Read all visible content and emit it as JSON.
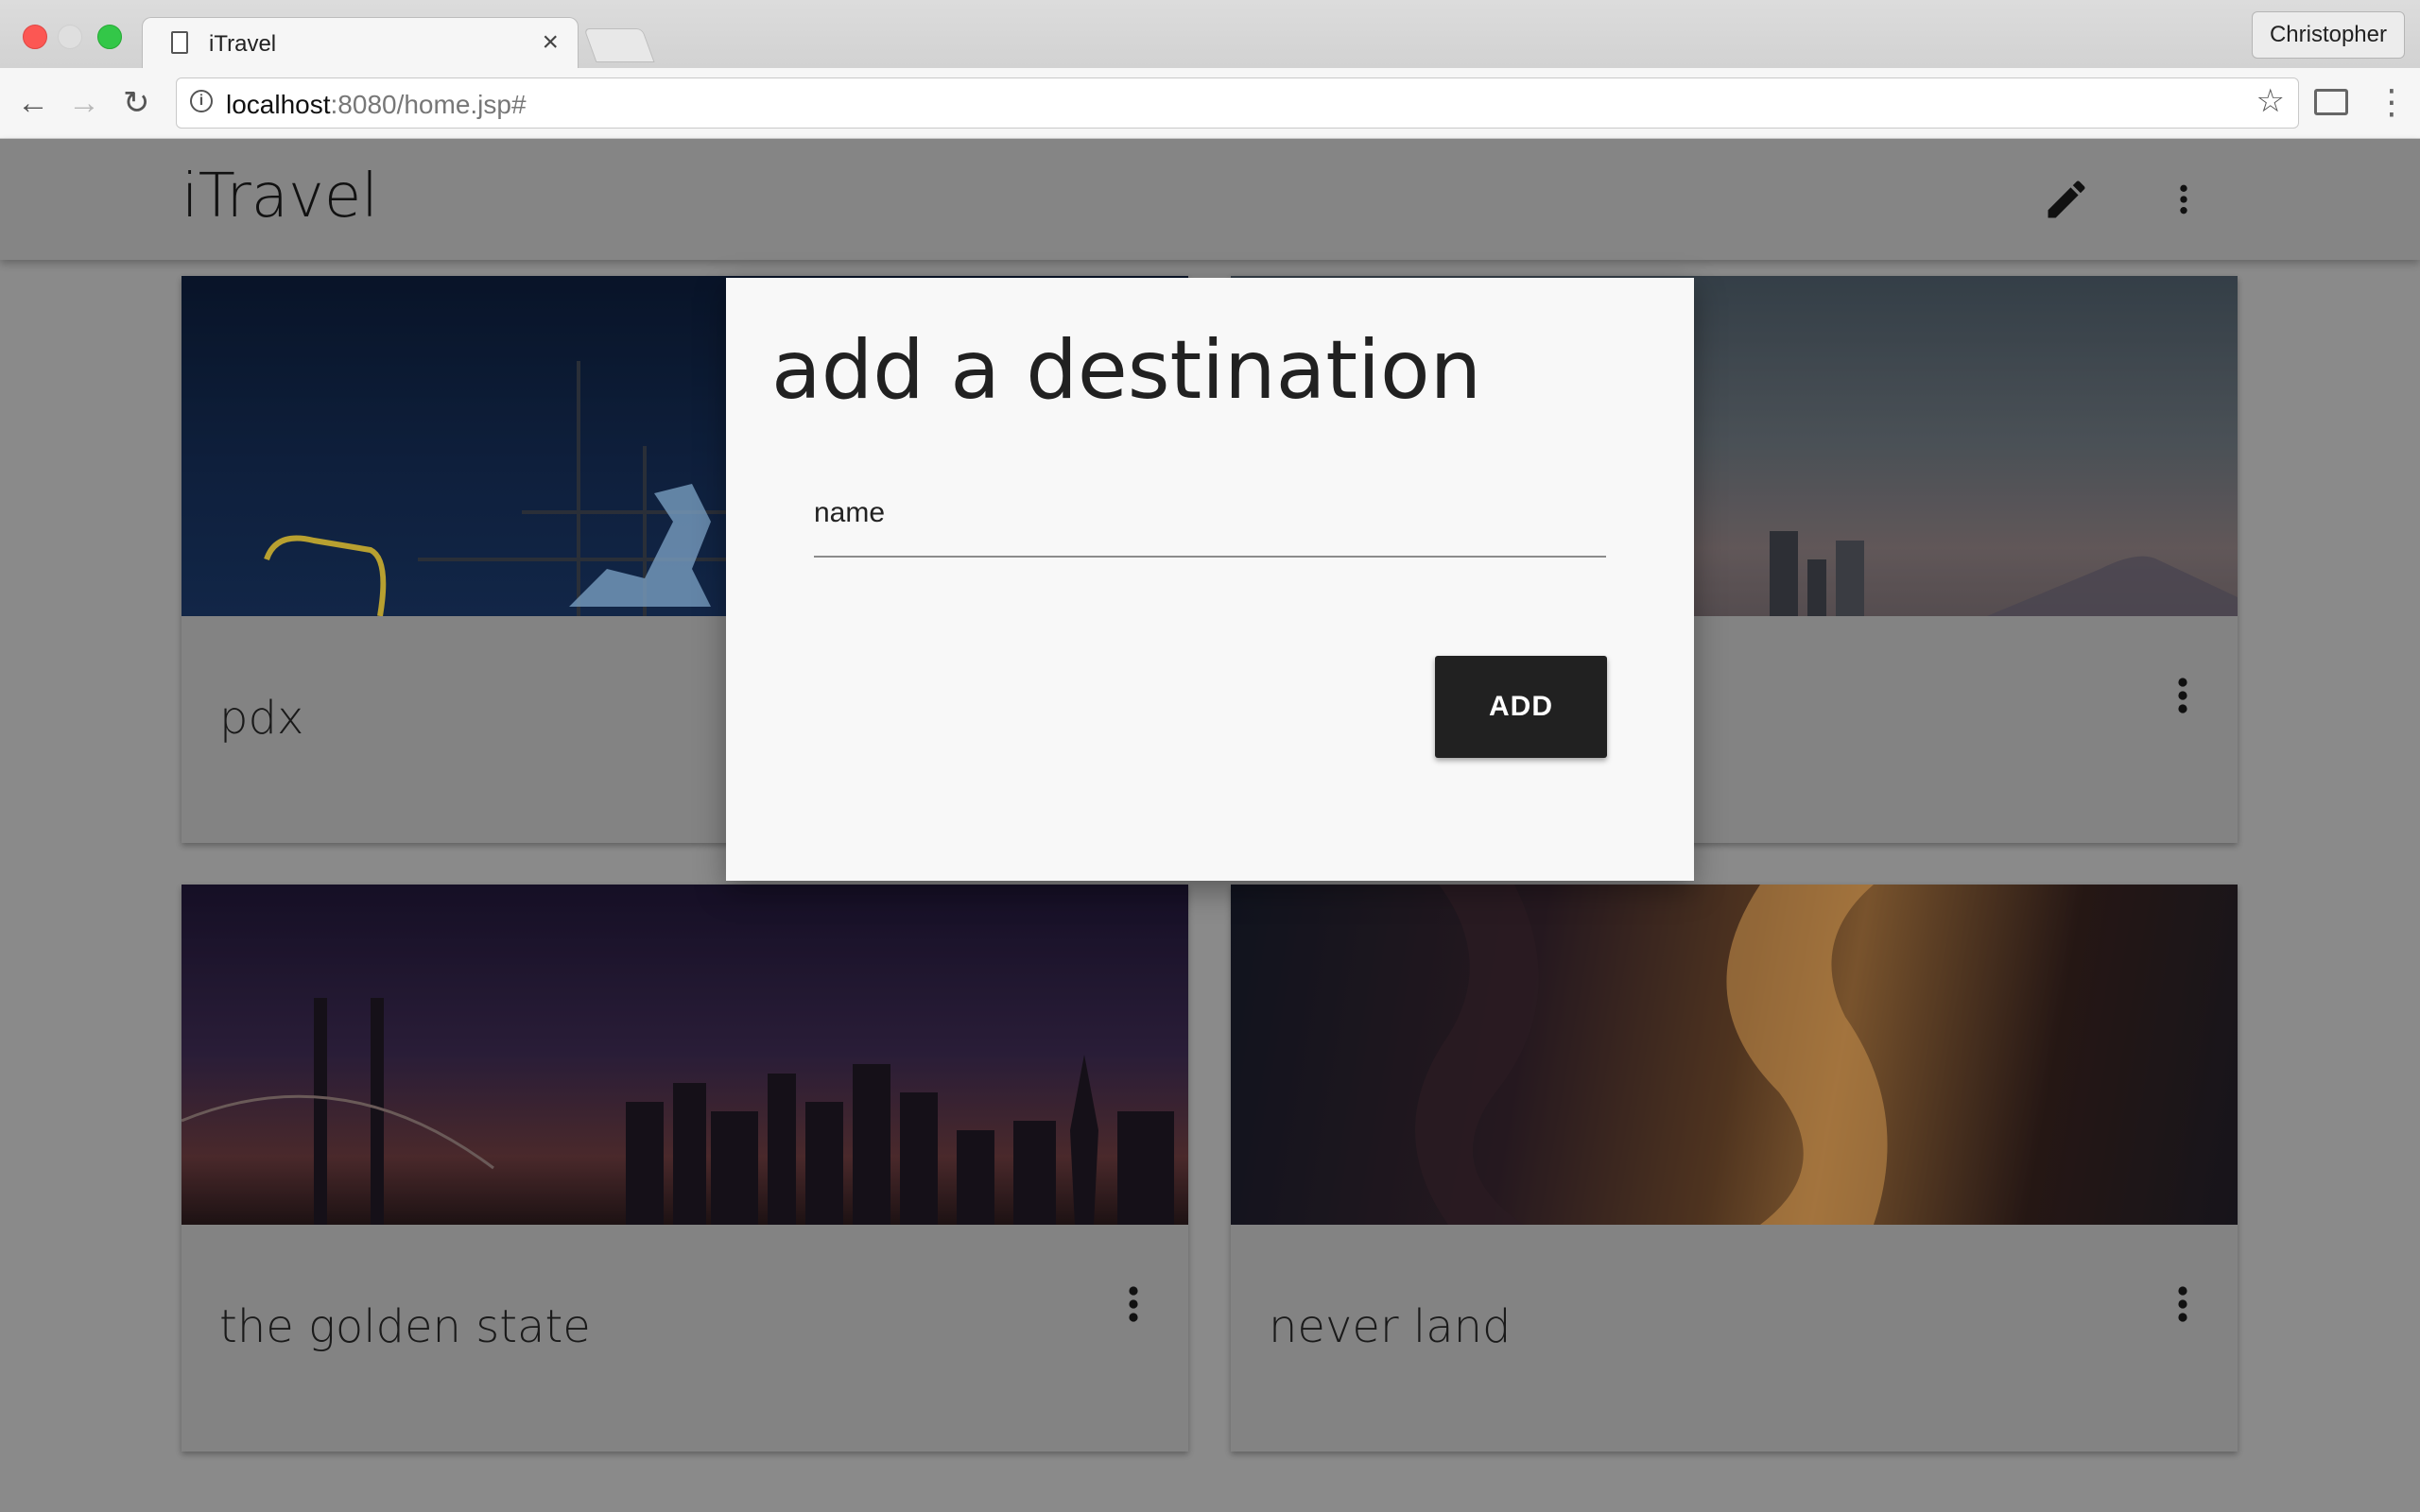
{
  "browser": {
    "tab_title": "iTravel",
    "tab_close": "×",
    "profile": "Christopher",
    "url_host": "localhost",
    "url_rest": ":8080/home.jsp#",
    "back": "←",
    "forward": "→",
    "reload": "↻",
    "star": "☆",
    "menu": "⋮",
    "info": "i"
  },
  "app": {
    "title": "iTravel",
    "icons": [
      "edit-icon",
      "more-vert-icon"
    ]
  },
  "cards": [
    {
      "name": "pdx"
    },
    {
      "name": ""
    },
    {
      "name": "the golden state"
    },
    {
      "name": "never land"
    }
  ],
  "dialog": {
    "title": "add a destination",
    "name_label": "name",
    "name_value": "",
    "add_label": "ADD"
  },
  "colors": {
    "scrim": "#8a8a8a",
    "dialog_bg": "#f8f8f8",
    "button_bg": "#212121",
    "button_text": "#ffffff"
  }
}
